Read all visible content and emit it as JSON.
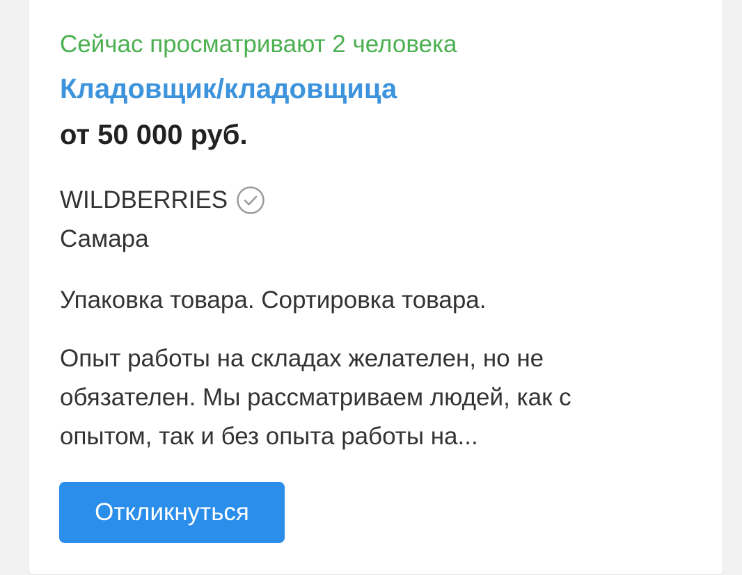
{
  "vacancy": {
    "viewers_text": "Сейчас просматривают 2 человека",
    "title": "Кладовщик/кладовщица",
    "salary": "от 50 000 руб.",
    "company": "WILDBERRIES",
    "company_badge_icon": "verified-check-icon",
    "city": "Самара",
    "duties": "Упаковка товара. Сортировка товара.",
    "description": "Опыт работы на складах желателен, но не обязателен. Мы рассматриваем людей, как с опытом, так и без опыта работы на...",
    "apply_label": "Откликнуться"
  },
  "colors": {
    "viewers": "#4cb051",
    "title": "#3d93dc",
    "button": "#2a8eea",
    "text": "#333333"
  }
}
